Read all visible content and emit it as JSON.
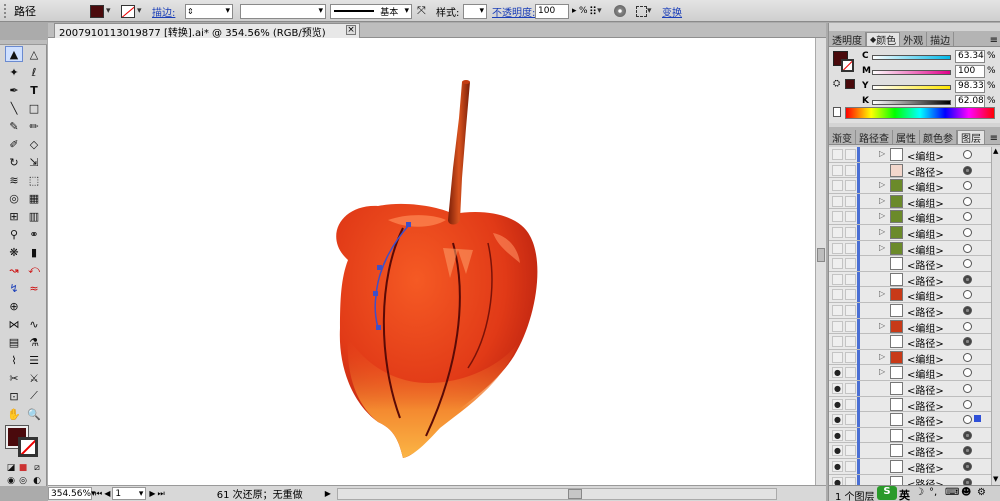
{
  "control_bar": {
    "mode_label": "路径",
    "stroke_label": "描边:",
    "stroke_style_label": "基本",
    "style_label": "样式:",
    "opacity_label": "不透明度:",
    "opacity_value": "100",
    "opacity_unit": "%",
    "transform_label": "变换"
  },
  "document": {
    "tab_title": "2007910113019877 [转换].ai* @ 354.56% (RGB/预览)",
    "close_symbol": "×"
  },
  "status_bar": {
    "zoom_value": "354.56%",
    "page_value": "1",
    "status_text": "61 次还原；无重做"
  },
  "panels": {
    "top_tabs": [
      "透明度",
      "颜色",
      "外观",
      "描边"
    ],
    "color": {
      "rows": [
        {
          "label": "C",
          "value": "63.34",
          "unit": "%"
        },
        {
          "label": "M",
          "value": "100",
          "unit": "%"
        },
        {
          "label": "Y",
          "value": "98.33",
          "unit": "%"
        },
        {
          "label": "K",
          "value": "62.08",
          "unit": "%"
        }
      ],
      "fill_color": "#4a0a0c"
    },
    "mid_tabs": [
      "渐变",
      "路径查",
      "属性",
      "颜色参",
      "图层"
    ],
    "layers": [
      {
        "name": "<编组>",
        "twisty": true,
        "eye": false,
        "target": "o",
        "selected": false
      },
      {
        "name": "<路径>",
        "twisty": false,
        "eye": false,
        "target": "f",
        "selected": false
      },
      {
        "name": "<编组>",
        "twisty": true,
        "eye": false,
        "target": "o",
        "selected": false
      },
      {
        "name": "<编组>",
        "twisty": true,
        "eye": false,
        "target": "o",
        "selected": false
      },
      {
        "name": "<编组>",
        "twisty": true,
        "eye": false,
        "target": "o",
        "selected": false
      },
      {
        "name": "<编组>",
        "twisty": true,
        "eye": false,
        "target": "o",
        "selected": false
      },
      {
        "name": "<编组>",
        "twisty": true,
        "eye": false,
        "target": "o",
        "selected": false
      },
      {
        "name": "<路径>",
        "twisty": false,
        "eye": false,
        "target": "o",
        "selected": false
      },
      {
        "name": "<路径>",
        "twisty": false,
        "eye": false,
        "target": "f",
        "selected": false
      },
      {
        "name": "<编组>",
        "twisty": true,
        "eye": false,
        "target": "o",
        "selected": false
      },
      {
        "name": "<路径>",
        "twisty": false,
        "eye": false,
        "target": "f",
        "selected": false
      },
      {
        "name": "<编组>",
        "twisty": true,
        "eye": false,
        "target": "o",
        "selected": false
      },
      {
        "name": "<路径>",
        "twisty": false,
        "eye": false,
        "target": "f",
        "selected": false
      },
      {
        "name": "<编组>",
        "twisty": true,
        "eye": false,
        "target": "o",
        "selected": false
      },
      {
        "name": "<编组>",
        "twisty": true,
        "eye": true,
        "target": "o",
        "selected": false
      },
      {
        "name": "<路径>",
        "twisty": false,
        "eye": true,
        "target": "o",
        "selected": false
      },
      {
        "name": "<路径>",
        "twisty": false,
        "eye": true,
        "target": "o",
        "selected": false
      },
      {
        "name": "<路径>",
        "twisty": false,
        "eye": true,
        "target": "o",
        "selected": true
      },
      {
        "name": "<路径>",
        "twisty": false,
        "eye": true,
        "target": "f",
        "selected": false
      },
      {
        "name": "<路径>",
        "twisty": false,
        "eye": true,
        "target": "f",
        "selected": false
      },
      {
        "name": "<路径>",
        "twisty": false,
        "eye": true,
        "target": "f",
        "selected": false
      },
      {
        "name": "<路径>",
        "twisty": false,
        "eye": true,
        "target": "f",
        "selected": false
      }
    ],
    "layer_footer": "1 个图层"
  },
  "ime": {
    "label": "英"
  },
  "colors": {
    "accent": "#1a3eb8",
    "selection": "#2f50d8",
    "fruit_main": "#e8421e",
    "fruit_dark": "#a8150c",
    "fruit_light": "#f79a3a",
    "stem": "#b5350f"
  }
}
